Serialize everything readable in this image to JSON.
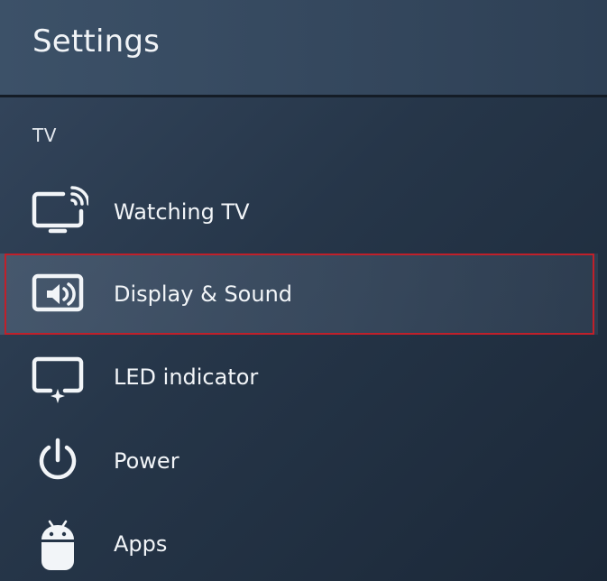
{
  "header": {
    "title": "Settings"
  },
  "section": {
    "label": "TV"
  },
  "menu": {
    "items": [
      {
        "label": "Watching TV",
        "icon": "tv-broadcast-icon"
      },
      {
        "label": "Display & Sound",
        "icon": "display-sound-icon",
        "selected": true
      },
      {
        "label": "LED indicator",
        "icon": "led-indicator-icon"
      },
      {
        "label": "Power",
        "icon": "power-icon"
      },
      {
        "label": "Apps",
        "icon": "android-icon"
      }
    ]
  },
  "colors": {
    "selection_border": "#c0202a",
    "background": "#263649",
    "text": "#f2f5f8"
  }
}
